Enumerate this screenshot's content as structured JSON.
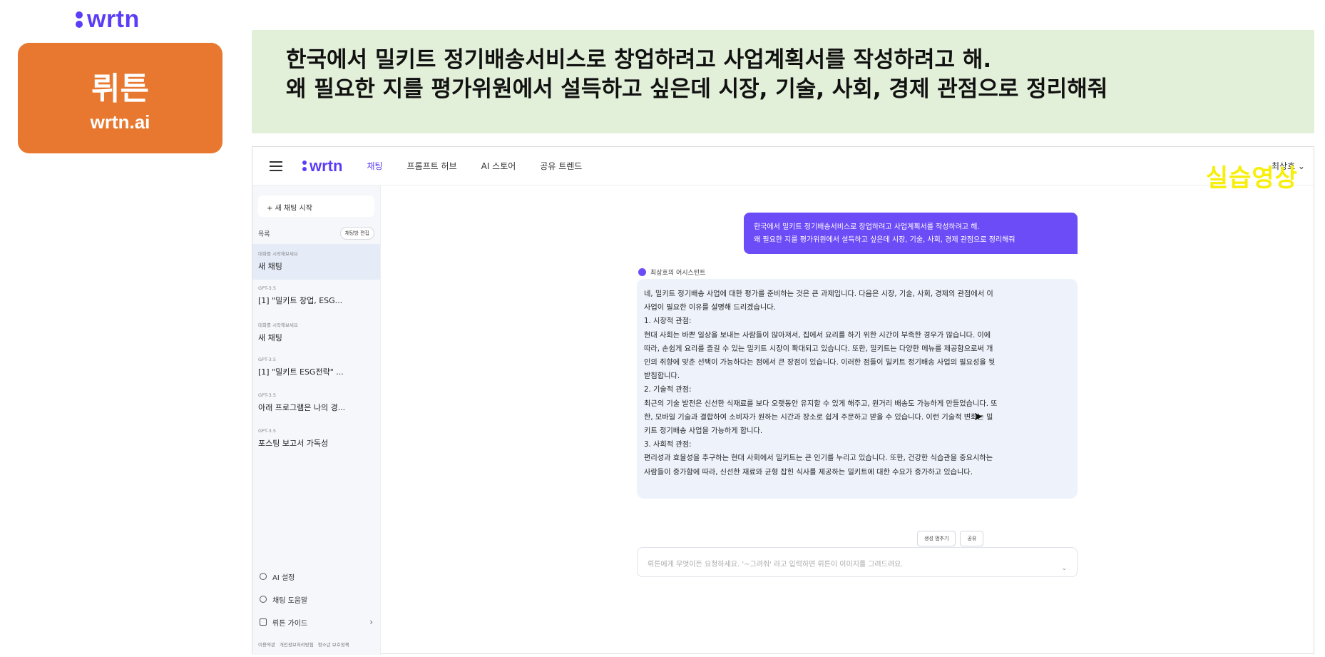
{
  "brand": {
    "name": "wrtn"
  },
  "card": {
    "title": "뤼튼",
    "subtitle": "wrtn.ai"
  },
  "banner": {
    "line1": "한국에서 밀키트 정기배송서비스로 창업하려고 사업계획서를 작성하려고 해.",
    "line2": "왜 필요한 지를 평가위원에서 설득하고 싶은데 시장, 기술, 사회, 경제 관점으로 정리해줘"
  },
  "app": {
    "logo": "wrtn",
    "tabs": [
      "채팅",
      "프롬프트 허브",
      "AI 스토어",
      "공유 트렌드"
    ],
    "user": "최상호 ⌄",
    "overlay": "실습영상"
  },
  "sidebar": {
    "new_chat": "+ 새 채팅 시작",
    "list_title": "목록",
    "edit_label": "채팅방 편집",
    "items": [
      {
        "model": "대화를 시작해보세요",
        "title": "새 채팅"
      },
      {
        "model": "GPT-3.5",
        "title": "[1] \"밀키트 창업, ESG..."
      },
      {
        "model": "대화를 시작해보세요",
        "title": "새 채팅"
      },
      {
        "model": "GPT-3.5",
        "title": "[1] \"밀키트 ESG전략\" ..."
      },
      {
        "model": "GPT-3.5",
        "title": "아래 프로그램은 나의 경..."
      },
      {
        "model": "GPT-3.5",
        "title": "포스팅 보고서 가독성"
      }
    ],
    "bottom": [
      "AI 설정",
      "채팅 도움말",
      "뤼튼 가이드"
    ],
    "footer": [
      "이용약관",
      "개인정보처리방침",
      "청소년 보호정책"
    ]
  },
  "chat": {
    "user_line1": "한국에서 밀키트 정기배송서비스로 창업하려고 사업계획서를 작성하려고 해.",
    "user_line2": "왜 필요한 지를 평가위원에서 설득하고 싶은데 시장, 기술, 사회, 경제 관점으로 정리해줘",
    "assistant_name": "최상호의 어시스턴트",
    "answer_lines": [
      "네, 밀키트 정기배송 사업에 대한 평가를 준비하는 것은 큰 과제입니다. 다음은 시장, 기술, 사회, 경제의 관점에서 이",
      "사업이 필요한 이유를 설명해 드리겠습니다.",
      "1. 시장적 관점:",
      "현대 사회는 바쁜 일상을 보내는 사람들이 많아져서, 집에서 요리를 하기 위한 시간이 부족한 경우가 많습니다. 이에",
      "따라, 손쉽게 요리를 즐길 수 있는 밀키트 시장이 확대되고 있습니다. 또한, 밀키트는 다양한 메뉴를 제공함으로써 개",
      "인의 취향에 맞춘 선택이 가능하다는 점에서 큰 장점이 있습니다. 이러한 점들이 밀키트 정기배송 사업의 필요성을 뒷",
      "받침합니다.",
      "2. 기술적 관점:",
      "최근의 기술 발전은 신선한 식재료를 보다 오랫동안 유지할 수 있게 해주고, 원거리 배송도 가능하게 만들었습니다. 또",
      "한, 모바일 기술과 결합하여 소비자가 원하는 시간과 장소로 쉽게 주문하고 받을 수 있습니다. 이런 기술적 변화는 밀",
      "키트 정기배송 사업을 가능하게 합니다.",
      "3. 사회적 관점:",
      "편리성과 효율성을 추구하는 현대 사회에서 밀키트는 큰 인기를 누리고 있습니다. 또한, 건강한 식습관을 중요시하는",
      "사람들이 증가함에 따라, 신선한 재료와 균형 잡힌 식사를 제공하는 밀키트에 대한 수요가 증가하고 있습니다."
    ],
    "stop_label": "생성 멈추기",
    "share_label": "공유",
    "input_placeholder": "뤼튼에게 무엇이든 요청하세요. '~그려줘' 라고 입력하면 뤼튼이 이미지를 그려드려요."
  },
  "colors": {
    "brand": "#5b3df5",
    "orange": "#e8782f",
    "banner_bg": "#e2efd9",
    "bubble": "#6c4cf7",
    "overlay": "#f7ee0a"
  }
}
